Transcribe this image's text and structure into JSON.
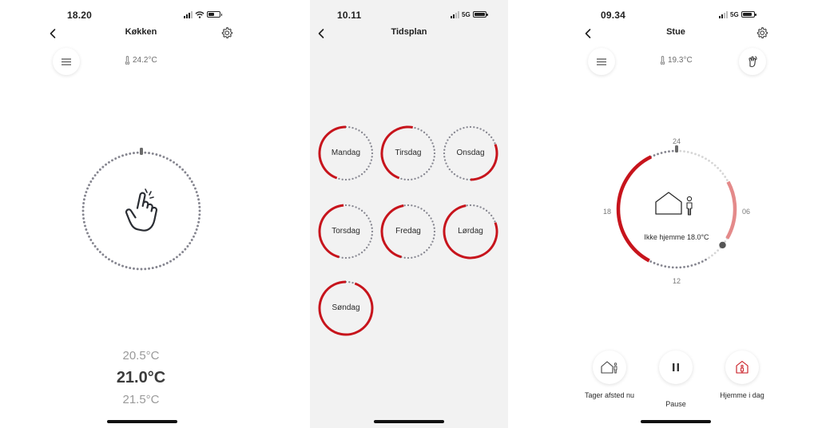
{
  "theme": {
    "accent": "#c7141c",
    "accent_light": "#e48a8a",
    "dot": "#85858f",
    "dot_light": "#d6d6d6"
  },
  "screen1": {
    "time": "18.20",
    "title": "Køkken",
    "room_temp": "24.2°C",
    "picker": {
      "above": "20.5°C",
      "selected": "21.0°C",
      "below": "21.5°C"
    }
  },
  "screen2": {
    "time": "10.11",
    "network": "5G",
    "title": "Tidsplan",
    "days": [
      {
        "label": "Mandag"
      },
      {
        "label": "Tirsdag"
      },
      {
        "label": "Onsdag"
      },
      {
        "label": "Torsdag"
      },
      {
        "label": "Fredag"
      },
      {
        "label": "Lørdag"
      },
      {
        "label": "Søndag"
      }
    ]
  },
  "screen3": {
    "time": "09.34",
    "network": "5G",
    "title": "Stue",
    "room_temp": "19.3°C",
    "dial_labels": {
      "top": "24",
      "right": "06",
      "bottom": "12",
      "left": "18"
    },
    "status": "Ikke hjemme 18.0°C",
    "actions": [
      {
        "label": "Tager afsted nu",
        "icon": "leaving-home-icon"
      },
      {
        "label": "Pause",
        "icon": "pause-icon"
      },
      {
        "label": "Hjemme i dag",
        "icon": "home-today-icon"
      }
    ]
  }
}
